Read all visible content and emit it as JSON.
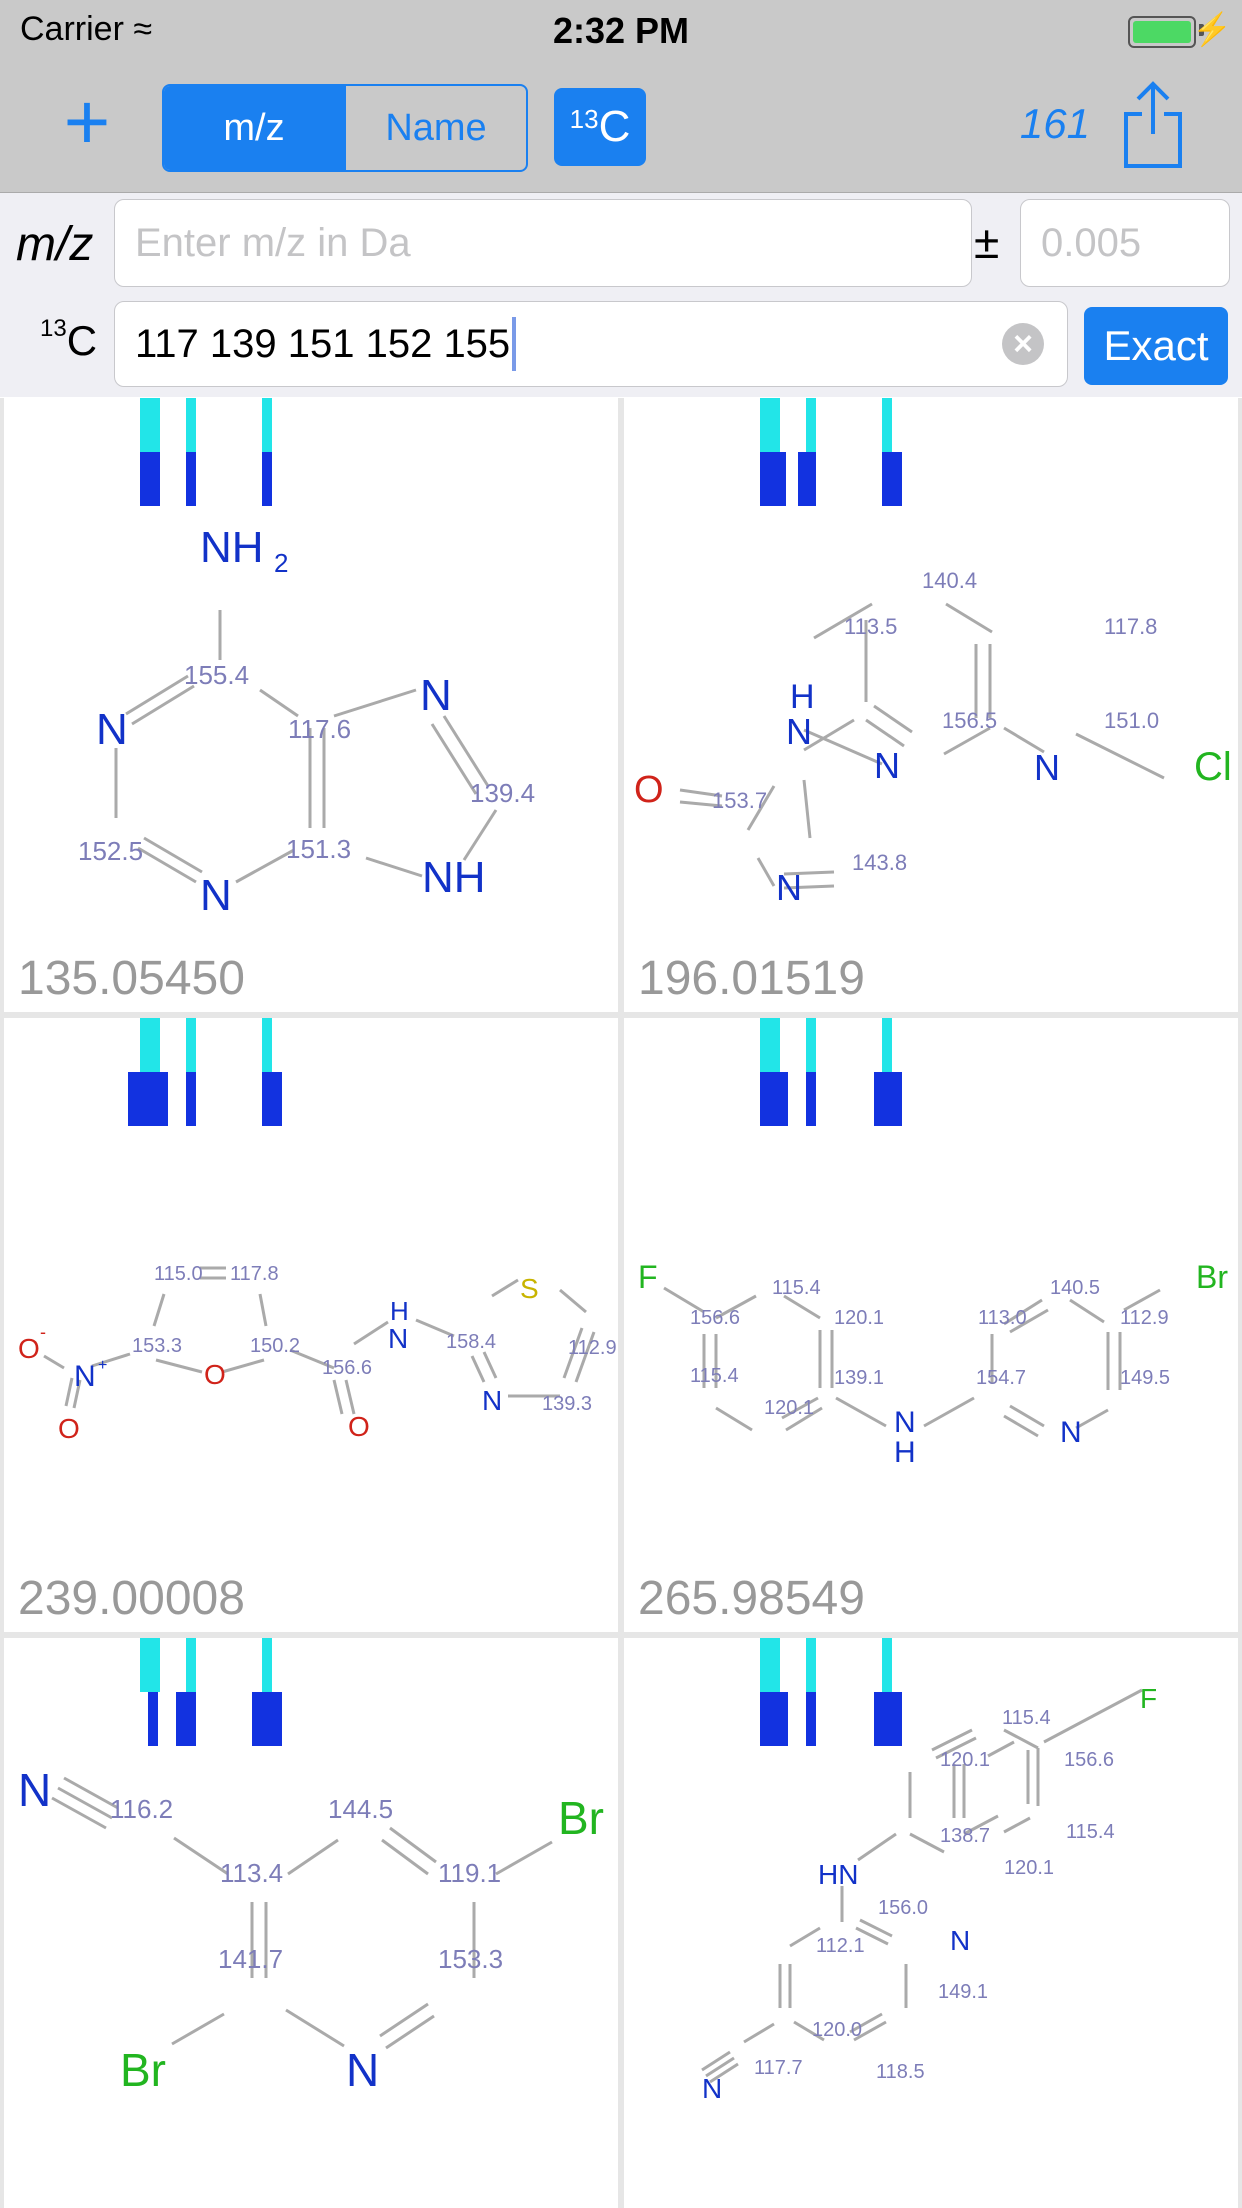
{
  "status_bar": {
    "carrier": "Carrier",
    "time": "2:32 PM"
  },
  "toolbar": {
    "add_label": "+",
    "segment_mz": "m/z",
    "segment_name": "Name",
    "c13_label": "C",
    "c13_sup": "13",
    "count": "161"
  },
  "search": {
    "mz_label": "m/z",
    "mz_placeholder": "Enter m/z in Da",
    "pm_label": "±",
    "tolerance_placeholder": "0.005",
    "c13_label": "C",
    "c13_sup": "13",
    "c13_value": "117 139 151 152 155",
    "exact_label": "Exact"
  },
  "colors": {
    "accent": "#1a80f0",
    "bar_light": "#22e5e8",
    "bar_dark": "#1232e0"
  },
  "results": [
    {
      "mass": "135.05450",
      "atoms": [
        "NH",
        "2",
        "N",
        "N",
        "N",
        "NH"
      ],
      "shifts": [
        "155.4",
        "117.6",
        "139.4",
        "152.5",
        "151.3"
      ]
    },
    {
      "mass": "196.01519",
      "atoms": [
        "H",
        "N",
        "N",
        "N",
        "N",
        "O",
        "Cl"
      ],
      "shifts": [
        "140.4",
        "113.5",
        "117.8",
        "156.5",
        "151.0",
        "153.7",
        "143.8"
      ]
    },
    {
      "mass": "239.00008",
      "atoms": [
        "O",
        "-",
        "N",
        "+",
        "O",
        "O",
        "O",
        "H",
        "N",
        "S",
        "N"
      ],
      "shifts": [
        "115.0",
        "117.8",
        "153.3",
        "150.2",
        "156.6",
        "158.4",
        "112.9",
        "139.3"
      ]
    },
    {
      "mass": "265.98549",
      "atoms": [
        "F",
        "Br",
        "N",
        "H",
        "N"
      ],
      "shifts": [
        "115.4",
        "156.6",
        "120.1",
        "115.4",
        "139.1",
        "120.1",
        "140.5",
        "113.0",
        "112.9",
        "154.7",
        "149.5"
      ]
    },
    {
      "mass": "",
      "atoms": [
        "N",
        "Br",
        "Br",
        "N"
      ],
      "shifts": [
        "116.2",
        "144.5",
        "113.4",
        "119.1",
        "141.7",
        "153.3"
      ]
    },
    {
      "mass": "",
      "atoms": [
        "F",
        "HN",
        "N",
        "N"
      ],
      "shifts": [
        "115.4",
        "120.1",
        "156.6",
        "138.7",
        "115.4",
        "120.1",
        "156.0",
        "112.1",
        "149.1",
        "120.0",
        "118.5",
        "117.7"
      ]
    }
  ]
}
